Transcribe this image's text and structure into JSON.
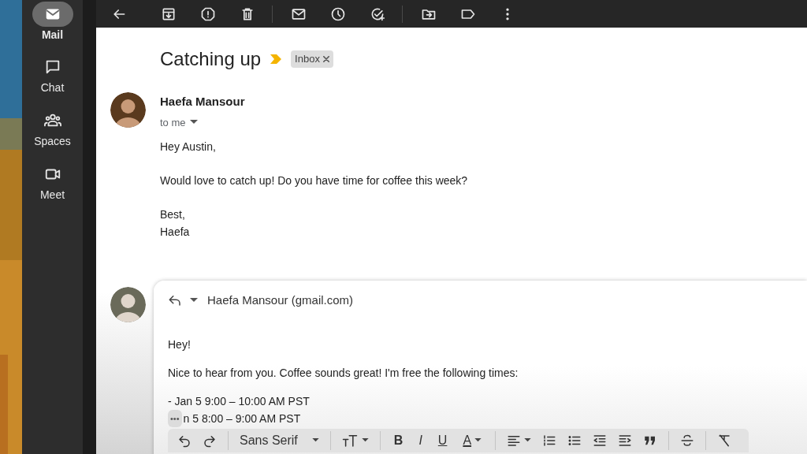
{
  "sidebar": {
    "items": [
      {
        "label": "Mail",
        "selected": true
      },
      {
        "label": "Chat",
        "selected": false
      },
      {
        "label": "Spaces",
        "selected": false
      },
      {
        "label": "Meet",
        "selected": false
      }
    ]
  },
  "thread": {
    "subject": "Catching up",
    "important": true,
    "labels": [
      {
        "text": "Inbox",
        "removable": true
      }
    ]
  },
  "message": {
    "sender": "Haefa Mansour",
    "recipient": "to me",
    "paragraphs": [
      [
        "Hey Austin,"
      ],
      [
        "Would love to catch up! Do you have time for coffee this week?"
      ],
      [
        "Best,",
        "Haefa"
      ]
    ]
  },
  "reply": {
    "recipient": "Haefa Mansour (gmail.com)",
    "paragraphs": [
      [
        "Hey!"
      ],
      [
        "Nice to hear from you. Coffee sounds great! I'm free the following times:"
      ],
      [
        "- Jan 5 9:00 – 10:00 AM PST"
      ]
    ],
    "trimmed_marker": "•••",
    "partial_line": "n 5 8:00 – 9:00 AM PST"
  },
  "format_bar": {
    "font": "Sans Serif",
    "letters": [
      "B",
      "I",
      "U",
      "A"
    ]
  }
}
